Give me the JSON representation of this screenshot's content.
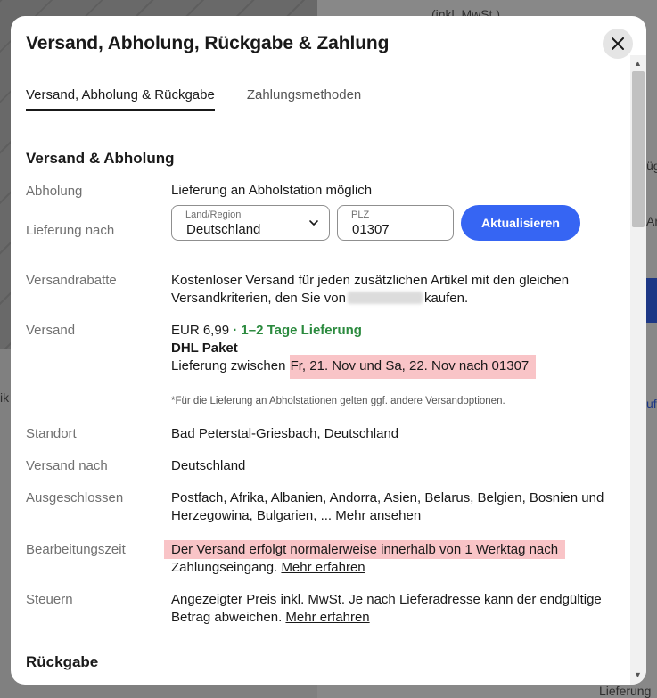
{
  "backdrop": {
    "text_top_right": "(inkl. MwSt.)",
    "text_left": "ik",
    "text_right_1": "üg",
    "text_right_2": "Ar",
    "text_right_3": "uf",
    "text_bottom_right": "Lieferung"
  },
  "modal": {
    "title": "Versand, Abholung, Rückgabe & Zahlung",
    "close_icon": "close-icon"
  },
  "tabs": [
    {
      "label": "Versand, Abholung & Rückgabe",
      "active": true
    },
    {
      "label": "Zahlungsmethoden",
      "active": false
    }
  ],
  "shipping": {
    "section_title": "Versand & Abholung",
    "pickup": {
      "label": "Abholung",
      "value": "Lieferung an Abholstation möglich"
    },
    "delivery_to": {
      "label": "Lieferung nach",
      "country_label": "Land/Region",
      "country_value": "Deutschland",
      "zip_label": "PLZ",
      "zip_value": "01307",
      "update_button": "Aktualisieren"
    },
    "discounts": {
      "label": "Versandrabatte",
      "line1": "Kostenloser Versand für jeden zusätzlichen Artikel mit den gleichen",
      "line2_before": "Versandkriterien, den Sie von",
      "line2_after": "kaufen."
    },
    "shipping": {
      "label": "Versand",
      "price": "EUR 6,99",
      "speed": "· 1–2 Tage Lieferung",
      "carrier": "DHL Paket",
      "window_prefix": "Lieferung zwischen",
      "window_dates": "Fr, 21. Nov und Sa, 22. Nov nach 01307",
      "note": "*Für die Lieferung an Abholstationen gelten ggf. andere Versandoptionen."
    },
    "location": {
      "label": "Standort",
      "value": "Bad Peterstal-Griesbach, Deutschland"
    },
    "ships_to": {
      "label": "Versand nach",
      "value": "Deutschland"
    },
    "excluded": {
      "label": "Ausgeschlossen",
      "line1": "Postfach, Afrika, Albanien, Andorra, Asien, Belarus, Belgien, Bosnien und",
      "line2": "Herzegowina, Bulgarien, ...",
      "link": "Mehr ansehen"
    },
    "handling": {
      "label": "Bearbeitungszeit",
      "line1": "Der Versand erfolgt normalerweise innerhalb von 1 Werktag nach",
      "line2": "Zahlungseingang.",
      "link": "Mehr erfahren"
    },
    "taxes": {
      "label": "Steuern",
      "line1": "Angezeigter Preis inkl. MwSt. Je nach Lieferadresse kann der endgültige",
      "line2": "Betrag abweichen.",
      "link": "Mehr erfahren"
    }
  },
  "returns": {
    "section_title": "Rückgabe"
  },
  "colors": {
    "accent": "#3665f3",
    "green": "#2b8a3e",
    "highlight": "#f9c4c7"
  }
}
